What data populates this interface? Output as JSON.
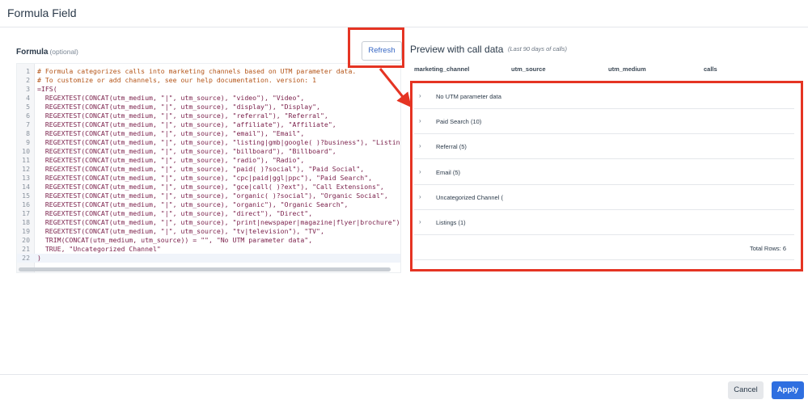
{
  "dialog": {
    "title": "Formula Field"
  },
  "formula": {
    "label": "Formula",
    "optional": "(optional)",
    "lines": [
      {
        "n": "1",
        "text": "# Formula categorizes calls into marketing channels based on UTM parameter data.",
        "kind": "comment"
      },
      {
        "n": "2",
        "text": "# To customize or add channels, see our help documentation. version: 1",
        "kind": "comment"
      },
      {
        "n": "3",
        "text": "=IFS(",
        "kind": "code"
      },
      {
        "n": "4",
        "text": "  REGEXTEST(CONCAT(utm_medium, \"|\", utm_source), \"video\"), \"Video\",",
        "kind": "code"
      },
      {
        "n": "5",
        "text": "  REGEXTEST(CONCAT(utm_medium, \"|\", utm_source), \"display\"), \"Display\",",
        "kind": "code"
      },
      {
        "n": "6",
        "text": "  REGEXTEST(CONCAT(utm_medium, \"|\", utm_source), \"referral\"), \"Referral\",",
        "kind": "code"
      },
      {
        "n": "7",
        "text": "  REGEXTEST(CONCAT(utm_medium, \"|\", utm_source), \"affiliate\"), \"Affiliate\",",
        "kind": "code"
      },
      {
        "n": "8",
        "text": "  REGEXTEST(CONCAT(utm_medium, \"|\", utm_source), \"email\"), \"Email\",",
        "kind": "code"
      },
      {
        "n": "9",
        "text": "  REGEXTEST(CONCAT(utm_medium, \"|\", utm_source), \"listing|gmb|google( )?business\"), \"Listings\"",
        "kind": "code"
      },
      {
        "n": "10",
        "text": "  REGEXTEST(CONCAT(utm_medium, \"|\", utm_source), \"billboard\"), \"Billboard\",",
        "kind": "code"
      },
      {
        "n": "11",
        "text": "  REGEXTEST(CONCAT(utm_medium, \"|\", utm_source), \"radio\"), \"Radio\",",
        "kind": "code"
      },
      {
        "n": "12",
        "text": "  REGEXTEST(CONCAT(utm_medium, \"|\", utm_source), \"paid( )?social\"), \"Paid Social\",",
        "kind": "code"
      },
      {
        "n": "13",
        "text": "  REGEXTEST(CONCAT(utm_medium, \"|\", utm_source), \"cpc|paid|ggl|ppc\"), \"Paid Search\",",
        "kind": "code"
      },
      {
        "n": "14",
        "text": "  REGEXTEST(CONCAT(utm_medium, \"|\", utm_source), \"gce|call( )?ext\"), \"Call Extensions\",",
        "kind": "code"
      },
      {
        "n": "15",
        "text": "  REGEXTEST(CONCAT(utm_medium, \"|\", utm_source), \"organic( )?social\"), \"Organic Social\",",
        "kind": "code"
      },
      {
        "n": "16",
        "text": "  REGEXTEST(CONCAT(utm_medium, \"|\", utm_source), \"organic\"), \"Organic Search\",",
        "kind": "code"
      },
      {
        "n": "17",
        "text": "  REGEXTEST(CONCAT(utm_medium, \"|\", utm_source), \"direct\"), \"Direct\",",
        "kind": "code"
      },
      {
        "n": "18",
        "text": "  REGEXTEST(CONCAT(utm_medium, \"|\", utm_source), \"print|newspaper|magazine|flyer|brochure\"), \"",
        "kind": "code"
      },
      {
        "n": "19",
        "text": "  REGEXTEST(CONCAT(utm_medium, \"|\", utm_source), \"tv|television\"), \"TV\",",
        "kind": "code"
      },
      {
        "n": "20",
        "text": "  TRIM(CONCAT(utm_medium, utm_source)) = \"\", \"No UTM parameter data\",",
        "kind": "code"
      },
      {
        "n": "21",
        "text": "  TRUE, \"Uncategorized Channel\"",
        "kind": "code"
      },
      {
        "n": "22",
        "text": ")",
        "kind": "code"
      }
    ]
  },
  "refresh": {
    "label": "Refresh"
  },
  "preview": {
    "title": "Preview with call data",
    "subtitle": "(Last 90 days of calls)",
    "columns": [
      "marketing_channel",
      "utm_source",
      "utm_medium",
      "calls"
    ],
    "rows": [
      "No UTM parameter data",
      "Paid Search (10)",
      "Referral (5)",
      "Email (5)",
      "Uncategorized Channel (",
      "Listings (1)"
    ],
    "total": "Total Rows: 6"
  },
  "footer": {
    "cancel_label": "Cancel",
    "apply_label": "Apply"
  },
  "colors": {
    "accent": "#2f6fe0",
    "highlight": "#e53423",
    "link": "#3566c4"
  }
}
